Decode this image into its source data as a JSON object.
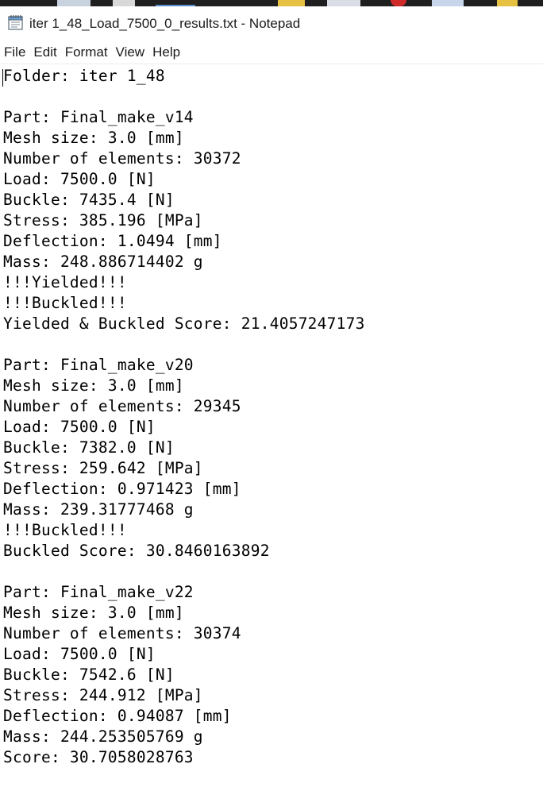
{
  "window": {
    "title": "iter 1_48_Load_7500_0_results.txt - Notepad",
    "icon": "notepad-icon"
  },
  "menu": {
    "items": [
      "File",
      "Edit",
      "Format",
      "View",
      "Help"
    ]
  },
  "document": {
    "lines": [
      "Folder: iter 1_48",
      "",
      "Part: Final_make_v14",
      "Mesh size: 3.0 [mm]",
      "Number of elements: 30372",
      "Load: 7500.0 [N]",
      "Buckle: 7435.4 [N]",
      "Stress: 385.196 [MPa]",
      "Deflection: 1.0494 [mm]",
      "Mass: 248.886714402 g",
      "!!!Yielded!!!",
      "!!!Buckled!!!",
      "Yielded & Buckled Score: 21.4057247173",
      "",
      "Part: Final_make_v20",
      "Mesh size: 3.0 [mm]",
      "Number of elements: 29345",
      "Load: 7500.0 [N]",
      "Buckle: 7382.0 [N]",
      "Stress: 259.642 [MPa]",
      "Deflection: 0.971423 [mm]",
      "Mass: 239.31777468 g",
      "!!!Buckled!!!",
      "Buckled Score: 30.8460163892",
      "",
      "Part: Final_make_v22",
      "Mesh size: 3.0 [mm]",
      "Number of elements: 30374",
      "Load: 7500.0 [N]",
      "Buckle: 7542.6 [N]",
      "Stress: 244.912 [MPa]",
      "Deflection: 0.94087 [mm]",
      "Mass: 244.253505769 g",
      "Score: 30.7058028763"
    ]
  },
  "colors": {
    "taskbar": "#1f1f1f",
    "window_bg": "#ffffff",
    "text": "#000000"
  }
}
